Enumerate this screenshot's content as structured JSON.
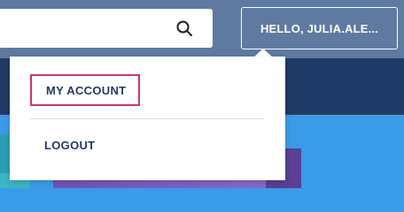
{
  "header": {
    "search": {
      "placeholder": "",
      "icon": "search-icon"
    },
    "account_button_label": "HELLO, JULIA.ALE...",
    "account_button_border_color": "#ffffff"
  },
  "account_menu": {
    "items": [
      {
        "label": "MY ACCOUNT",
        "highlighted": true,
        "highlight_color": "#d6306f"
      },
      {
        "label": "LOGOUT",
        "highlighted": false
      }
    ],
    "text_color": "#1f3a66"
  },
  "colors": {
    "topbar": "#5f7aa0",
    "navband": "#1f3a66",
    "hero": "#3a9be8"
  }
}
